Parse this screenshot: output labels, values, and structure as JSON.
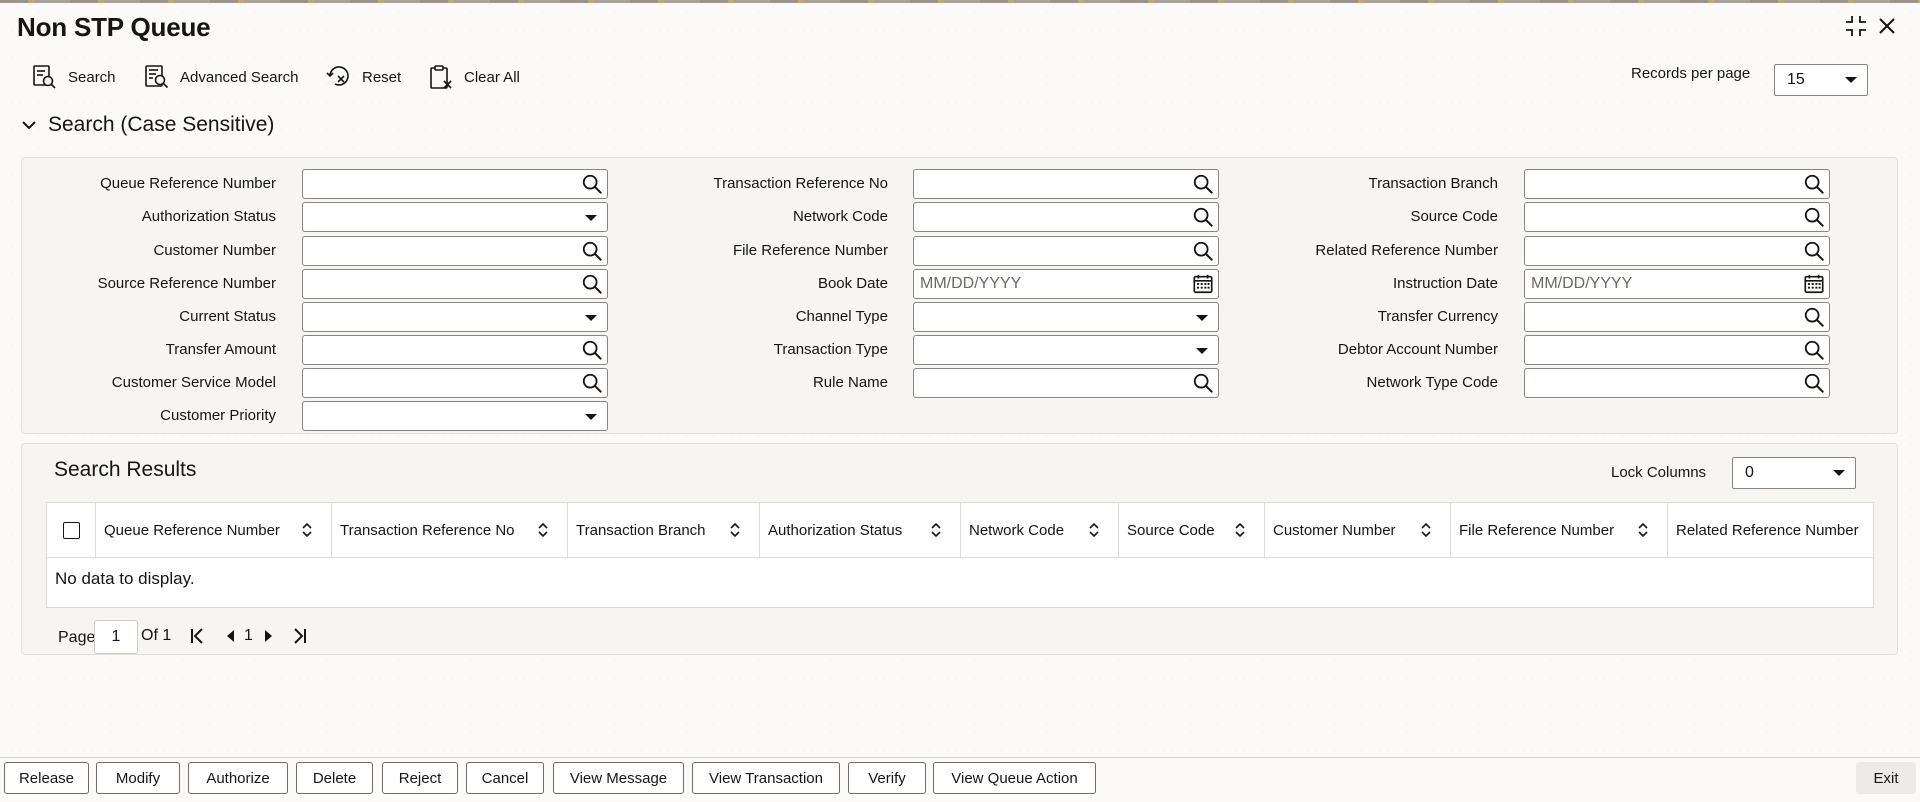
{
  "window": {
    "title": "Non STP Queue"
  },
  "toolbar": {
    "search_label": "Search",
    "advanced_search_label": "Advanced Search",
    "reset_label": "Reset",
    "clear_all_label": "Clear All",
    "records_per_page_label": "Records per page",
    "records_per_page_value": "15"
  },
  "search_section": {
    "title": "Search (Case Sensitive)",
    "date_placeholder": "MM/DD/YYYY",
    "fields": {
      "queue_reference_number": "Queue Reference Number",
      "authorization_status": "Authorization Status",
      "customer_number": "Customer Number",
      "source_reference_number": "Source Reference Number",
      "current_status": "Current Status",
      "transfer_amount": "Transfer Amount",
      "customer_service_model": "Customer Service Model",
      "customer_priority": "Customer Priority",
      "transaction_reference_no": "Transaction Reference No",
      "network_code": "Network Code",
      "file_reference_number": "File Reference Number",
      "book_date": "Book Date",
      "channel_type": "Channel Type",
      "transaction_type": "Transaction Type",
      "rule_name": "Rule Name",
      "transaction_branch": "Transaction Branch",
      "source_code": "Source Code",
      "related_reference_number": "Related Reference Number",
      "instruction_date": "Instruction Date",
      "transfer_currency": "Transfer Currency",
      "debtor_account_number": "Debtor Account Number",
      "network_type_code": "Network Type Code"
    }
  },
  "results": {
    "title": "Search Results",
    "lock_columns_label": "Lock Columns",
    "lock_columns_value": "0",
    "columns": [
      "Queue Reference Number",
      "Transaction Reference No",
      "Transaction Branch",
      "Authorization Status",
      "Network Code",
      "Source Code",
      "Customer Number",
      "File Reference Number",
      "Related Reference Number"
    ],
    "empty_message": "No data to display."
  },
  "pagination": {
    "page_label": "Page",
    "current_page": "1",
    "of_label": "Of 1",
    "page_number": "1"
  },
  "actions": {
    "release": "Release",
    "modify": "Modify",
    "authorize": "Authorize",
    "delete": "Delete",
    "reject": "Reject",
    "cancel": "Cancel",
    "view_message": "View Message",
    "view_transaction": "View Transaction",
    "verify": "Verify",
    "view_queue_action": "View Queue Action",
    "exit": "Exit"
  }
}
